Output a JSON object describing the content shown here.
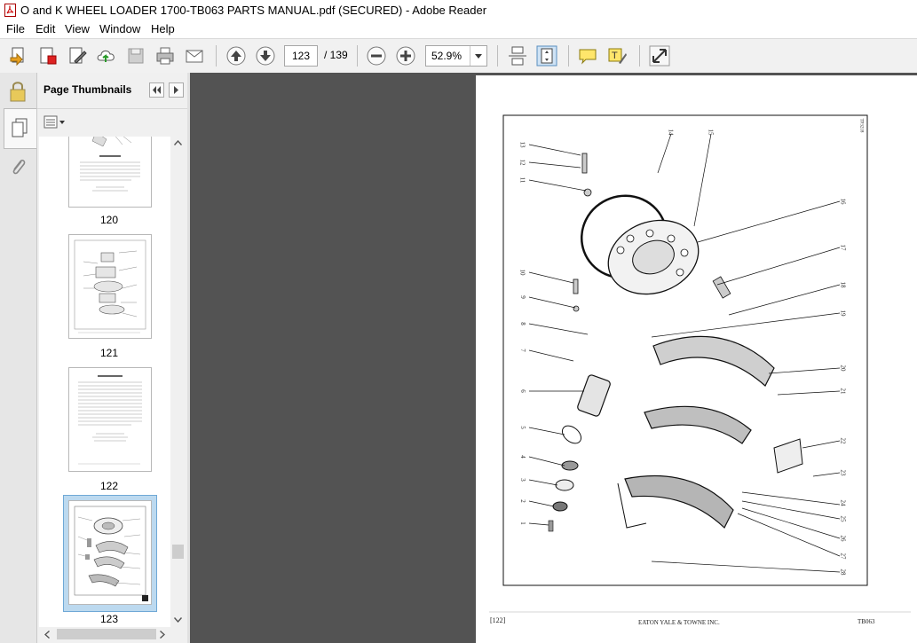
{
  "window": {
    "title": "O and K WHEEL LOADER 1700-TB063 PARTS MANUAL.pdf (SECURED) - Adobe Reader"
  },
  "menu": [
    "File",
    "Edit",
    "View",
    "Window",
    "Help"
  ],
  "toolbar": {
    "current_page": "123",
    "page_count": "/ 139",
    "zoom": "52.9%"
  },
  "thumbnails": {
    "panel_title": "Page Thumbnails",
    "pages": [
      {
        "num": "120",
        "selected": false
      },
      {
        "num": "121",
        "selected": false
      },
      {
        "num": "122",
        "selected": false
      },
      {
        "num": "123",
        "selected": true
      }
    ]
  },
  "document": {
    "left_callouts": [
      "13",
      "12",
      "11",
      "10",
      "9",
      "8",
      "7",
      "6",
      "5",
      "4",
      "3",
      "2",
      "1"
    ],
    "top_callouts": [
      "14",
      "15"
    ],
    "right_callouts": [
      "16",
      "17",
      "18",
      "19",
      "20",
      "21",
      "22",
      "23",
      "24",
      "25",
      "26",
      "27",
      "28"
    ],
    "figure_code": "TP3218",
    "footer_page": "[122]",
    "footer_company": "EATON YALE & TOWNE INC.",
    "footer_code": "TB063"
  }
}
